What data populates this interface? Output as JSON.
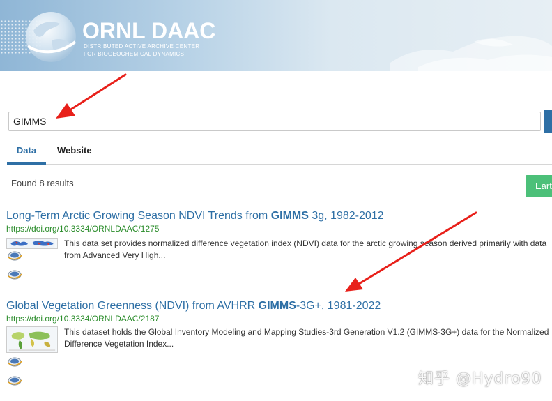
{
  "header": {
    "logo_title": "ORNL DAAC",
    "logo_subtitle_line1": "DISTRIBUTED ACTIVE ARCHIVE CENTER",
    "logo_subtitle_line2": "FOR BIOGEOCHEMICAL DYNAMICS"
  },
  "search": {
    "value": "GIMMS"
  },
  "tabs": [
    {
      "label": "Data",
      "active": true
    },
    {
      "label": "Website",
      "active": false
    }
  ],
  "results_summary": "Found 8 results",
  "earth_button_label": "Eart",
  "results": [
    {
      "title_before": "Long-Term Arctic Growing Season NDVI Trends from ",
      "title_highlight": "GIMMS",
      "title_after": " 3g, 1982-2012",
      "doi": "https://doi.org/10.3334/ORNLDAAC/1275",
      "description": "This data set provides normalized difference vegetation index (NDVI) data for the arctic growing season derived primarily with data from Advanced Very High..."
    },
    {
      "title_before": "Global Vegetation Greenness (NDVI) from AVHRR ",
      "title_highlight": "GIMMS",
      "title_after": "-3G+, 1981-2022",
      "doi": "https://doi.org/10.3334/ORNLDAAC/2187",
      "description": "This dataset holds the Global Inventory Modeling and Mapping Studies-3rd Generation V1.2 (GIMMS-3G+) data for the Normalized Difference Vegetation Index..."
    }
  ],
  "watermark": "知乎 @Hydro90",
  "colors": {
    "link": "#2e6fa5",
    "doi": "#2a8c2a",
    "arrow": "#e8201a",
    "earth_button": "#4cc079"
  }
}
